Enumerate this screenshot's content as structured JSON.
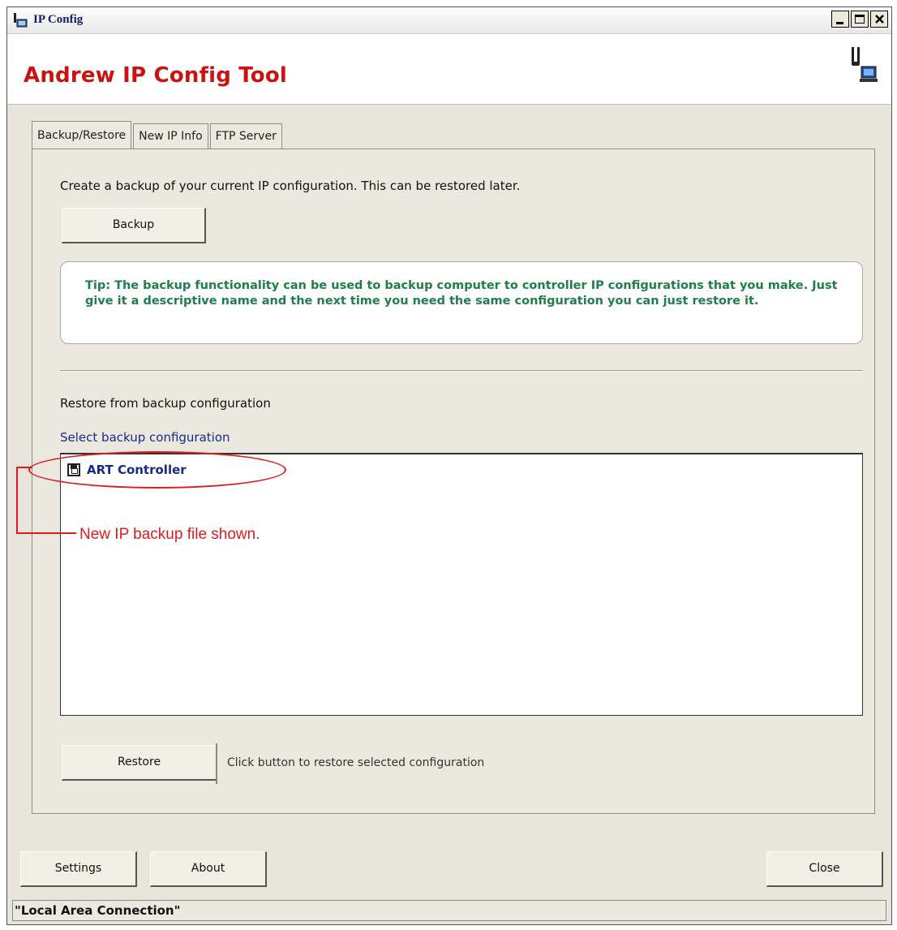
{
  "window": {
    "title": "IP Config"
  },
  "banner": {
    "heading": "Andrew IP Config Tool"
  },
  "tabs": [
    {
      "label": "Backup/Restore",
      "active": true
    },
    {
      "label": "New IP Info",
      "active": false
    },
    {
      "label": "FTP Server",
      "active": false
    }
  ],
  "backup": {
    "description": "Create a backup of your current IP configuration. This can be restored later.",
    "button_label": "Backup",
    "tip": "Tip: The backup functionality can be used to backup computer to controller IP configurations that you make.  Just give it a descriptive name and the next time you need the same configuration you can just restore it."
  },
  "restore": {
    "heading": "Restore from backup configuration",
    "select_label": "Select backup configuration",
    "items": [
      {
        "label": "ART Controller",
        "icon": "floppy-disk-icon"
      }
    ],
    "button_label": "Restore",
    "hint": "Click button to restore selected configuration"
  },
  "footer": {
    "settings_label": "Settings",
    "about_label": "About",
    "close_label": "Close"
  },
  "status": {
    "text": "\"Local Area Connection\""
  },
  "annotation": {
    "text": "New IP backup file shown.",
    "color": "#e01b1b"
  },
  "colors": {
    "heading_red": "#cc1111",
    "tip_green": "#1f7f4c",
    "list_blue": "#1a2a8a"
  }
}
